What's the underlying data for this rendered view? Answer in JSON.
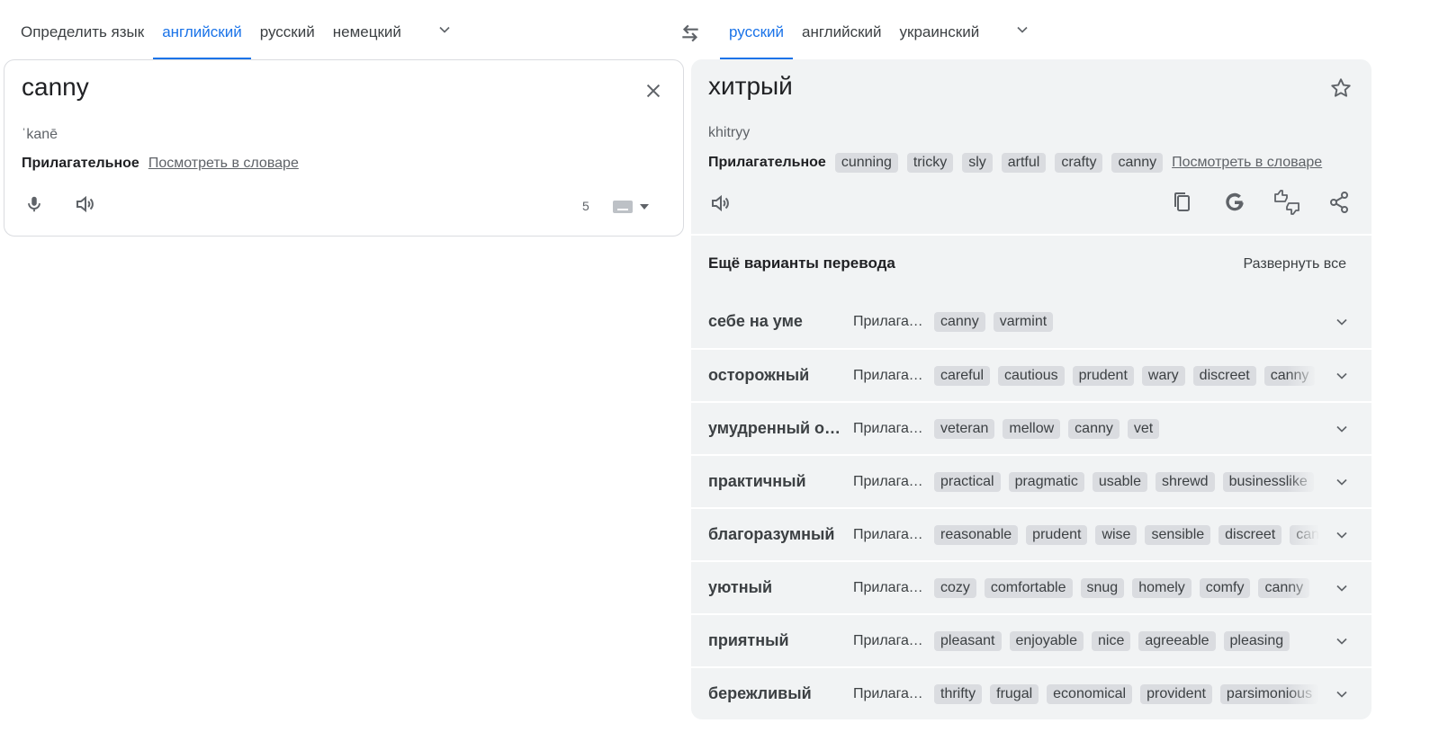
{
  "source_tabs": [
    "Определить язык",
    "английский",
    "русский",
    "немецкий"
  ],
  "target_tabs": [
    "русский",
    "английский",
    "украинский"
  ],
  "colors": {
    "accent": "#1a73e8",
    "panel": "#f1f3f4",
    "chip": "#dadce0"
  },
  "icons": {
    "more_langs": "chevron-down-icon",
    "swap": "swap-icon",
    "clear": "close-icon",
    "mic": "microphone-icon",
    "listen": "speaker-icon",
    "keyboard": "keyboard-icon",
    "star": "star-icon",
    "copy": "copy-icon",
    "google": "google-icon",
    "feedback": "feedback-icon",
    "share": "share-icon"
  },
  "source": {
    "text": "canny",
    "phonetic": "ˈkanē",
    "pos": "Прилагательное",
    "dict_link": "Посмотреть в словаре",
    "char_count": "5"
  },
  "target": {
    "text": "хитрый",
    "translit": "khitryy",
    "pos": "Прилагательное",
    "chips": [
      "cunning",
      "tricky",
      "sly",
      "artful",
      "crafty",
      "canny"
    ],
    "dict_link": "Посмотреть в словаре"
  },
  "more": {
    "title": "Ещё варианты перевода",
    "expand_all": "Развернуть все",
    "rows": [
      {
        "word": "себе на уме",
        "pos": "Прилагательное",
        "syn": [
          "canny",
          "varmint"
        ]
      },
      {
        "word": "осторожный",
        "pos": "Прилагательное",
        "syn": [
          "careful",
          "cautious",
          "prudent",
          "wary",
          "discreet",
          "canny"
        ]
      },
      {
        "word": "умудренный опытом",
        "pos": "Прилагательное",
        "syn": [
          "veteran",
          "mellow",
          "canny",
          "vet"
        ]
      },
      {
        "word": "практичный",
        "pos": "Прилагательное",
        "syn": [
          "practical",
          "pragmatic",
          "usable",
          "shrewd",
          "businesslike"
        ]
      },
      {
        "word": "благоразумный",
        "pos": "Прилагательное",
        "syn": [
          "reasonable",
          "prudent",
          "wise",
          "sensible",
          "discreet",
          "canny"
        ]
      },
      {
        "word": "уютный",
        "pos": "Прилагательное",
        "syn": [
          "cozy",
          "comfortable",
          "snug",
          "homely",
          "comfy",
          "canny"
        ]
      },
      {
        "word": "приятный",
        "pos": "Прилагательное",
        "syn": [
          "pleasant",
          "enjoyable",
          "nice",
          "agreeable",
          "pleasing"
        ]
      },
      {
        "word": "бережливый",
        "pos": "Прилагательное",
        "syn": [
          "thrifty",
          "frugal",
          "economical",
          "provident",
          "parsimonious"
        ]
      }
    ]
  }
}
